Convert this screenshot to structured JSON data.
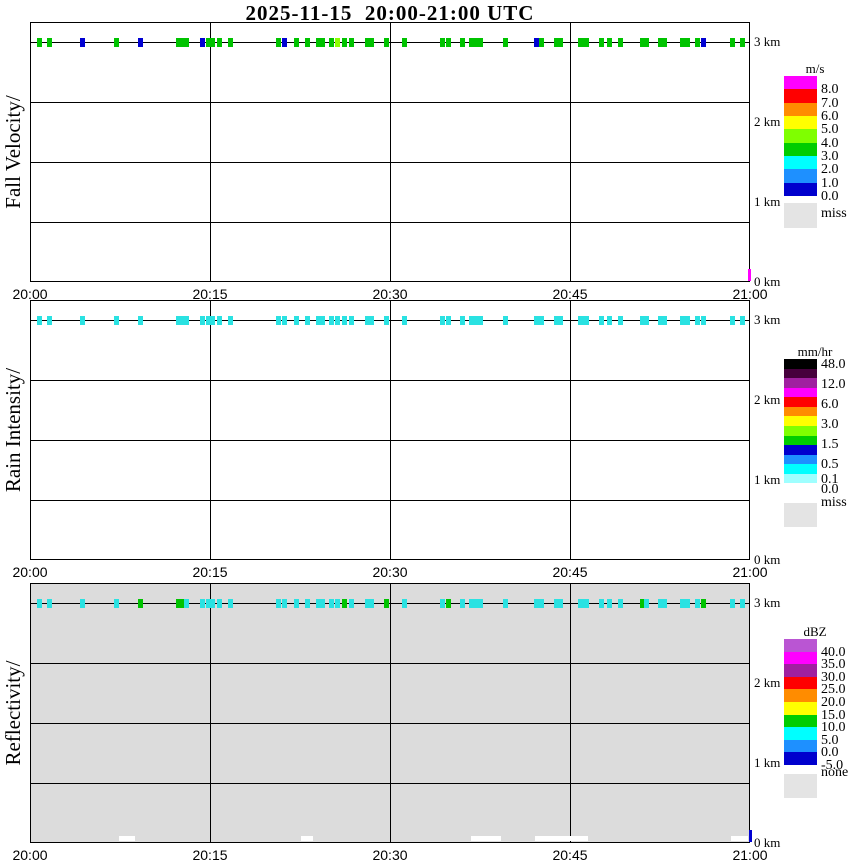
{
  "title": "2025-11-15  20:00-21:00 UTC",
  "palette": {
    "g": "#00C300",
    "b": "#0000D2",
    "c": "#2AE2E2",
    "y": "#8CFF00",
    "m": "#FF00FF",
    "w": "#FFFFFF",
    "panel3_bg": "#DCDCDC",
    "miss_gray": "#E4E4E4",
    "grid": "#000000"
  },
  "time_axis": {
    "ticks": [
      "20:00",
      "20:15",
      "20:30",
      "20:45",
      "21:00"
    ]
  },
  "height_axis": {
    "labels": [
      "3 km",
      "2 km",
      "1 km",
      "0 km"
    ]
  },
  "chart_data": [
    {
      "key": "fall-velocity",
      "type": "scatter",
      "panel_title": "Fall Velocity",
      "ylabel_text": "Fall Velocity/",
      "bg": "#FFFFFF",
      "x_axis": {
        "ticks": [
          "20:00",
          "20:15",
          "20:30",
          "20:45",
          "21:00"
        ],
        "range_minutes": [
          0,
          60
        ]
      },
      "y_axis": {
        "tick_labels": [
          "3 km",
          "2 km",
          "1 km",
          "0 km"
        ],
        "range_km": [
          0,
          3.25
        ],
        "grid_step_km": 0.75
      },
      "points_note": "detections on the 3.0 km line; t = minutes after 20:00 UTC; c = color bin (g=3-4 m/s green, b=0-1 m/s blue, y=4-5 m/s chartreuse)",
      "points": [
        {
          "t": 0.75,
          "c": "g"
        },
        {
          "t": 1.6,
          "c": "g"
        },
        {
          "t": 4.4,
          "c": "b"
        },
        {
          "t": 7.2,
          "c": "g"
        },
        {
          "t": 9.2,
          "c": "b"
        },
        {
          "t": 12.5,
          "c": "g",
          "w": 1
        },
        {
          "t": 13.0,
          "c": "g"
        },
        {
          "t": 14.4,
          "c": "b"
        },
        {
          "t": 15.0,
          "c": "g",
          "w": 1
        },
        {
          "t": 15.8,
          "c": "g"
        },
        {
          "t": 16.7,
          "c": "g"
        },
        {
          "t": 20.7,
          "c": "g"
        },
        {
          "t": 21.2,
          "c": "b"
        },
        {
          "t": 22.2,
          "c": "g"
        },
        {
          "t": 23.1,
          "c": "g"
        },
        {
          "t": 24.0,
          "c": "g"
        },
        {
          "t": 24.4,
          "c": "g"
        },
        {
          "t": 25.1,
          "c": "g"
        },
        {
          "t": 25.6,
          "c": "y"
        },
        {
          "t": 26.2,
          "c": "g"
        },
        {
          "t": 26.8,
          "c": "g"
        },
        {
          "t": 28.3,
          "c": "g",
          "w": 1
        },
        {
          "t": 29.7,
          "c": "g"
        },
        {
          "t": 31.2,
          "c": "g"
        },
        {
          "t": 34.4,
          "c": "g"
        },
        {
          "t": 34.9,
          "c": "g"
        },
        {
          "t": 36.0,
          "c": "g"
        },
        {
          "t": 36.8,
          "c": "g"
        },
        {
          "t": 37.2,
          "c": "g"
        },
        {
          "t": 37.5,
          "c": "g"
        },
        {
          "t": 39.6,
          "c": "g"
        },
        {
          "t": 42.2,
          "c": "b"
        },
        {
          "t": 42.6,
          "c": "g"
        },
        {
          "t": 44.0,
          "c": "g",
          "w": 1
        },
        {
          "t": 46.0,
          "c": "g",
          "w": 1
        },
        {
          "t": 46.4,
          "c": "g"
        },
        {
          "t": 47.6,
          "c": "g"
        },
        {
          "t": 48.3,
          "c": "g"
        },
        {
          "t": 49.2,
          "c": "g"
        },
        {
          "t": 51.0,
          "c": "g"
        },
        {
          "t": 51.4,
          "c": "g"
        },
        {
          "t": 52.5,
          "c": "g"
        },
        {
          "t": 52.9,
          "c": "g"
        },
        {
          "t": 54.4,
          "c": "g"
        },
        {
          "t": 54.8,
          "c": "g"
        },
        {
          "t": 55.6,
          "c": "g"
        },
        {
          "t": 56.1,
          "c": "b"
        },
        {
          "t": 58.5,
          "c": "g"
        },
        {
          "t": 59.4,
          "c": "g"
        }
      ],
      "corner_mark": {
        "t": 59.75,
        "c": "m",
        "h_km": 0
      },
      "colorbar": {
        "title": "m/s",
        "band_colors": [
          "#FF00FF",
          "#FF0000",
          "#FF8C00",
          "#FFFF00",
          "#7FFF00",
          "#00CD00",
          "#00FFFF",
          "#1E90FF",
          "#0000CD"
        ],
        "tick_labels": [
          "8.0",
          "7.0",
          "6.0",
          "5.0",
          "4.0",
          "3.0",
          "2.0",
          "1.0",
          "0.0"
        ],
        "extra": {
          "label": "miss",
          "color": "#E4E4E4"
        }
      }
    },
    {
      "key": "rain-intensity",
      "type": "scatter",
      "panel_title": "Rain Intensity",
      "ylabel_text": "Rain Intensity/",
      "bg": "#FFFFFF",
      "x_axis": {
        "ticks": [
          "20:00",
          "20:15",
          "20:30",
          "20:45",
          "21:00"
        ],
        "range_minutes": [
          0,
          60
        ]
      },
      "y_axis": {
        "tick_labels": [
          "3 km",
          "2 km",
          "1 km",
          "0 km"
        ],
        "range_km": [
          0,
          3.25
        ],
        "grid_step_km": 0.75
      },
      "points_note": "detections on the 3.0 km line; all in 0.0-0.1 mm/hr (cyan) bin",
      "points": [
        {
          "t": 0.75,
          "c": "c"
        },
        {
          "t": 1.6,
          "c": "c"
        },
        {
          "t": 4.4,
          "c": "c"
        },
        {
          "t": 7.2,
          "c": "c"
        },
        {
          "t": 9.2,
          "c": "c"
        },
        {
          "t": 12.5,
          "c": "c",
          "w": 1
        },
        {
          "t": 13.0,
          "c": "c"
        },
        {
          "t": 14.4,
          "c": "c"
        },
        {
          "t": 15.0,
          "c": "c",
          "w": 1
        },
        {
          "t": 15.8,
          "c": "c"
        },
        {
          "t": 16.7,
          "c": "c"
        },
        {
          "t": 20.7,
          "c": "c"
        },
        {
          "t": 21.2,
          "c": "c"
        },
        {
          "t": 22.2,
          "c": "c"
        },
        {
          "t": 23.1,
          "c": "c"
        },
        {
          "t": 24.0,
          "c": "c"
        },
        {
          "t": 24.4,
          "c": "c"
        },
        {
          "t": 25.1,
          "c": "c"
        },
        {
          "t": 25.6,
          "c": "c"
        },
        {
          "t": 26.2,
          "c": "c"
        },
        {
          "t": 26.8,
          "c": "c"
        },
        {
          "t": 28.3,
          "c": "c",
          "w": 1
        },
        {
          "t": 29.7,
          "c": "c"
        },
        {
          "t": 31.2,
          "c": "c"
        },
        {
          "t": 34.4,
          "c": "c"
        },
        {
          "t": 34.9,
          "c": "c"
        },
        {
          "t": 36.0,
          "c": "c"
        },
        {
          "t": 36.8,
          "c": "c"
        },
        {
          "t": 37.2,
          "c": "c"
        },
        {
          "t": 37.5,
          "c": "c"
        },
        {
          "t": 39.6,
          "c": "c"
        },
        {
          "t": 42.2,
          "c": "c"
        },
        {
          "t": 42.6,
          "c": "c"
        },
        {
          "t": 44.0,
          "c": "c",
          "w": 1
        },
        {
          "t": 46.0,
          "c": "c",
          "w": 1
        },
        {
          "t": 46.4,
          "c": "c"
        },
        {
          "t": 47.6,
          "c": "c"
        },
        {
          "t": 48.3,
          "c": "c"
        },
        {
          "t": 49.2,
          "c": "c"
        },
        {
          "t": 51.0,
          "c": "c"
        },
        {
          "t": 51.4,
          "c": "c"
        },
        {
          "t": 52.5,
          "c": "c"
        },
        {
          "t": 52.9,
          "c": "c"
        },
        {
          "t": 54.4,
          "c": "c"
        },
        {
          "t": 54.8,
          "c": "c"
        },
        {
          "t": 55.6,
          "c": "c"
        },
        {
          "t": 56.1,
          "c": "c"
        },
        {
          "t": 58.5,
          "c": "c"
        },
        {
          "t": 59.4,
          "c": "c"
        }
      ],
      "colorbar": {
        "title": "mm/hr",
        "band_colors": [
          "#000000",
          "#46003C",
          "#A020A0",
          "#FF00FF",
          "#FF0000",
          "#FF8C00",
          "#FFFF00",
          "#7FFF00",
          "#00CD00",
          "#0000CD",
          "#1E90FF",
          "#00FFFF",
          "#9FFFFF",
          "#FFFFFF"
        ],
        "tick_labels": [
          "48.0",
          "12.0",
          "6.0",
          "3.0",
          "1.5",
          "0.5",
          "0.1",
          "0.0"
        ],
        "extra": {
          "label": "miss",
          "color": "#E4E4E4"
        }
      }
    },
    {
      "key": "reflectivity",
      "type": "scatter",
      "panel_title": "Reflectivity",
      "ylabel_text": "Reflectivity/",
      "bg": "#DCDCDC",
      "x_axis": {
        "ticks": [
          "20:00",
          "20:15",
          "20:30",
          "20:45",
          "21:00"
        ],
        "range_minutes": [
          0,
          60
        ]
      },
      "y_axis": {
        "tick_labels": [
          "3 km",
          "2 km",
          "1 km",
          "0 km"
        ],
        "range_km": [
          0,
          3.25
        ],
        "grid_step_km": 0.75
      },
      "points_note": "detections on the 3.0 km line; c = 5-10 dBZ cyan, g = 10-15 dBZ green; white segments near 0 km",
      "points": [
        {
          "t": 0.75,
          "c": "c"
        },
        {
          "t": 1.6,
          "c": "c"
        },
        {
          "t": 4.4,
          "c": "c"
        },
        {
          "t": 7.2,
          "c": "c"
        },
        {
          "t": 9.2,
          "c": "g"
        },
        {
          "t": 12.5,
          "c": "g",
          "w": 1
        },
        {
          "t": 13.0,
          "c": "c"
        },
        {
          "t": 14.4,
          "c": "c"
        },
        {
          "t": 15.0,
          "c": "c",
          "w": 1
        },
        {
          "t": 15.8,
          "c": "c"
        },
        {
          "t": 16.7,
          "c": "c"
        },
        {
          "t": 20.7,
          "c": "c"
        },
        {
          "t": 21.2,
          "c": "c"
        },
        {
          "t": 22.2,
          "c": "c"
        },
        {
          "t": 23.1,
          "c": "c"
        },
        {
          "t": 24.0,
          "c": "c"
        },
        {
          "t": 24.4,
          "c": "c"
        },
        {
          "t": 25.1,
          "c": "c"
        },
        {
          "t": 25.6,
          "c": "c"
        },
        {
          "t": 26.2,
          "c": "g"
        },
        {
          "t": 26.8,
          "c": "c"
        },
        {
          "t": 28.3,
          "c": "c",
          "w": 1
        },
        {
          "t": 29.7,
          "c": "g"
        },
        {
          "t": 31.2,
          "c": "c"
        },
        {
          "t": 34.4,
          "c": "c"
        },
        {
          "t": 34.9,
          "c": "g"
        },
        {
          "t": 36.0,
          "c": "c"
        },
        {
          "t": 36.8,
          "c": "c"
        },
        {
          "t": 37.2,
          "c": "c"
        },
        {
          "t": 37.5,
          "c": "c"
        },
        {
          "t": 39.6,
          "c": "c"
        },
        {
          "t": 42.2,
          "c": "c"
        },
        {
          "t": 42.6,
          "c": "c"
        },
        {
          "t": 44.0,
          "c": "c",
          "w": 1
        },
        {
          "t": 46.0,
          "c": "c",
          "w": 1
        },
        {
          "t": 46.4,
          "c": "c"
        },
        {
          "t": 47.6,
          "c": "c"
        },
        {
          "t": 48.3,
          "c": "c"
        },
        {
          "t": 49.2,
          "c": "c"
        },
        {
          "t": 51.0,
          "c": "g"
        },
        {
          "t": 51.4,
          "c": "c"
        },
        {
          "t": 52.5,
          "c": "c"
        },
        {
          "t": 52.9,
          "c": "c"
        },
        {
          "t": 54.4,
          "c": "c"
        },
        {
          "t": 54.8,
          "c": "c"
        },
        {
          "t": 55.6,
          "c": "c"
        },
        {
          "t": 56.1,
          "c": "g"
        },
        {
          "t": 58.5,
          "c": "c"
        },
        {
          "t": 59.4,
          "c": "c"
        }
      ],
      "bottom_segments": [
        [
          7.3,
          8.6
        ],
        [
          22.5,
          23.5
        ],
        [
          36.7,
          39.2
        ],
        [
          42.0,
          46.4
        ],
        [
          58.3,
          59.7
        ]
      ],
      "corner_mark": {
        "t": 59.8,
        "c": "b",
        "h_km": 0
      },
      "colorbar": {
        "title": "dBZ",
        "band_colors": [
          "#BA55D3",
          "#FF00FF",
          "#A020A0",
          "#FF0000",
          "#FF8C00",
          "#FFFF00",
          "#00CD00",
          "#00FFFF",
          "#1E90FF",
          "#0000CD"
        ],
        "tick_labels": [
          "40.0",
          "35.0",
          "30.0",
          "25.0",
          "20.0",
          "15.0",
          "10.0",
          "5.0",
          "0.0",
          "-5.0"
        ],
        "extra": {
          "label": "none",
          "color": "#E4E4E4"
        }
      }
    }
  ]
}
